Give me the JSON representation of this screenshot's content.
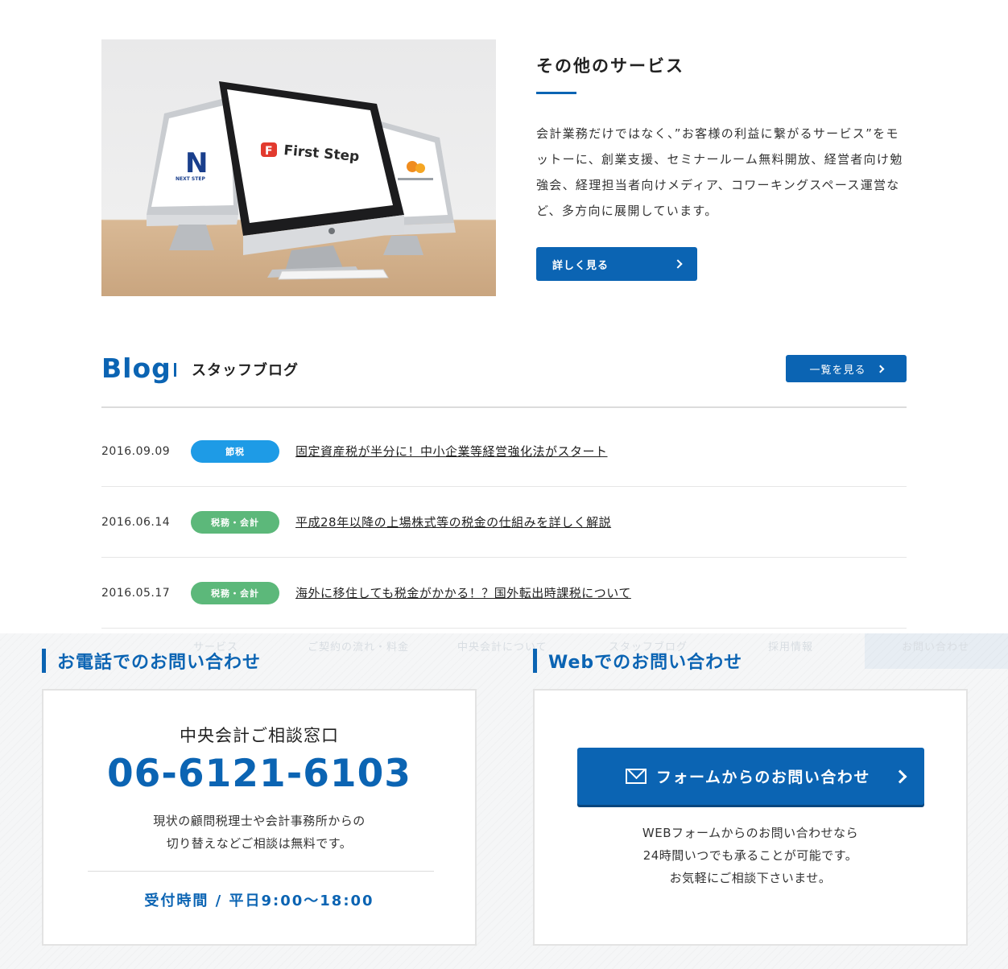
{
  "services": {
    "image_logos": {
      "center": "First Step",
      "left": "NEXT STEP"
    },
    "title": "その他のサービス",
    "description": "会計業務だけではなく、”お客様の利益に繋がるサービス”をモットーに、創業支援、セミナールーム無料開放、経営者向け勉強会、経理担当者向けメディア、コワーキングスペース運営など、多方向に展開しています。",
    "more_label": "詳しく見る"
  },
  "blog": {
    "title": "Blog",
    "subtitle": "スタッフブログ",
    "list_label": "一覧を見る",
    "posts": [
      {
        "date": "2016.09.09",
        "tag": "節税",
        "tag_color": "#1e9be6",
        "title": "固定資産税が半分に！中小企業等経営強化法がスタート"
      },
      {
        "date": "2016.06.14",
        "tag": "税務・会計",
        "tag_color": "#5cb87a",
        "title": "平成28年以降の上場株式等の税金の仕組みを詳しく解説"
      },
      {
        "date": "2016.05.17",
        "tag": "税務・会計",
        "tag_color": "#5cb87a",
        "title": "海外に移住しても税金がかかる！？国外転出時課税について"
      }
    ]
  },
  "ghost_nav": {
    "items": [
      "サービス",
      "ご契約の流れ・料金",
      "中央会計について",
      "スタッフブログ",
      "採用情報"
    ],
    "cta": "お問い合わせ"
  },
  "contact": {
    "phone_heading": "お電話でのお問い合わせ",
    "web_heading": "Webでのお問い合わせ",
    "phone_card": {
      "title": "中央会計ご相談窓口",
      "number": "06-6121-6103",
      "desc_line1": "現状の顧問税理士や会計事務所からの",
      "desc_line2": "切り替えなどご相談は無料です。",
      "hours": "受付時間 / 平日9:00〜18:00"
    },
    "web_card": {
      "button_label": "フォームからのお問い合わせ",
      "desc_line1": "WEBフォームからのお問い合わせなら",
      "desc_line2": "24時間いつでも承ることが可能です。",
      "desc_line3": "お気軽にご相談下さいませ。"
    }
  },
  "colors": {
    "brand": "#0b64b3",
    "tag_setsuzei": "#1e9be6",
    "tag_zeimu": "#5cb87a"
  }
}
